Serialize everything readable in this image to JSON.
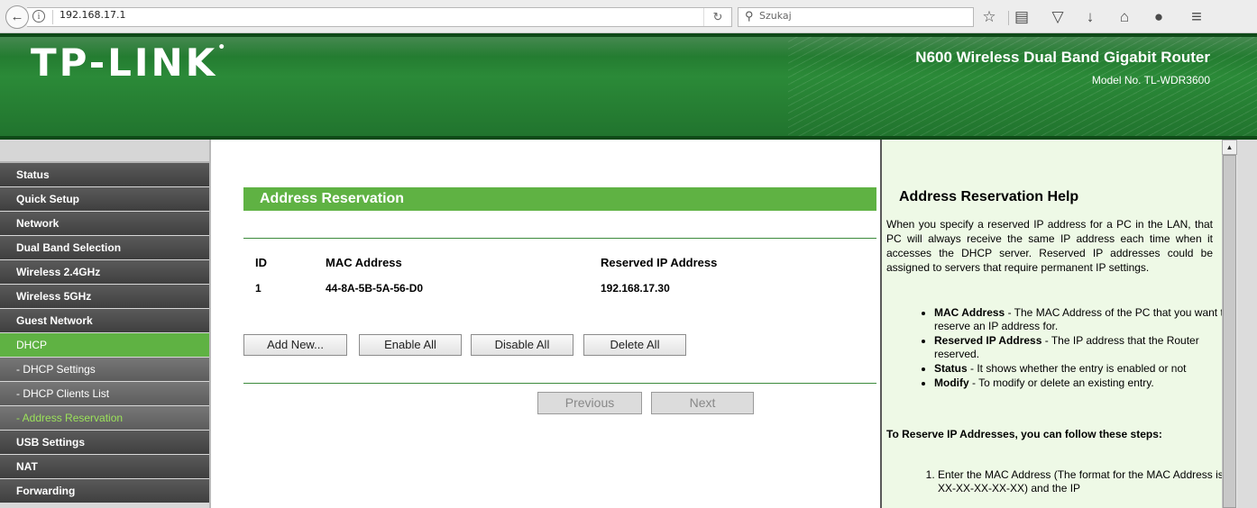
{
  "browser": {
    "back_icon": "back-arrow-icon",
    "info_icon": "info-icon",
    "url": "192.168.17.1",
    "reload_icon": "reload-icon",
    "search_placeholder": "Szukaj",
    "toolbar_icons": [
      "star-icon",
      "reading-list-icon",
      "pocket-icon",
      "download-icon",
      "home-icon",
      "chat-icon",
      "menu-icon"
    ]
  },
  "banner": {
    "logo": "TP-LINK",
    "product": "N600 Wireless Dual Band Gigabit Router",
    "model": "Model No. TL-WDR3600"
  },
  "menu": {
    "items": [
      {
        "label": "Status"
      },
      {
        "label": "Quick Setup"
      },
      {
        "label": "Network"
      },
      {
        "label": "Dual Band Selection"
      },
      {
        "label": "Wireless 2.4GHz"
      },
      {
        "label": "Wireless 5GHz"
      },
      {
        "label": "Guest Network"
      },
      {
        "label": "DHCP"
      },
      {
        "label": "- DHCP Settings"
      },
      {
        "label": "- DHCP Clients List"
      },
      {
        "label": "- Address Reservation"
      },
      {
        "label": "USB Settings"
      },
      {
        "label": "NAT"
      },
      {
        "label": "Forwarding"
      }
    ]
  },
  "main": {
    "title": "Address Reservation",
    "columns": [
      "ID",
      "MAC Address",
      "Reserved IP Address"
    ],
    "rows": [
      {
        "id": "1",
        "mac": "44-8A-5B-5A-56-D0",
        "ip": "192.168.17.30"
      }
    ],
    "buttons": {
      "add": "Add New...",
      "enable": "Enable All",
      "disable": "Disable All",
      "delete": "Delete All",
      "previous": "Previous",
      "next": "Next"
    }
  },
  "help": {
    "title": "Address Reservation Help",
    "intro": "When you specify a reserved IP address for a PC in the LAN, that PC will always receive the same IP address each time when it accesses the DHCP server. Reserved IP addresses could be assigned to servers that require permanent IP settings.",
    "items": [
      {
        "term": "MAC Address",
        "desc": " - The MAC Address of the PC that you want to reserve an IP address for."
      },
      {
        "term": "Reserved IP Address",
        "desc": " - The IP address that the Router reserved."
      },
      {
        "term": "Status",
        "desc": " - It shows whether the entry is enabled or not"
      },
      {
        "term": "Modify",
        "desc": " - To modify or delete an existing entry."
      }
    ],
    "steps_title": "To Reserve IP Addresses, you can follow these steps:",
    "step1": "Enter the MAC Address (The format for the MAC Address is XX-XX-XX-XX-XX-XX) and the IP"
  },
  "colors": {
    "accent": "#5fb243",
    "banner": "#2b8a38",
    "help_bg": "#eef9e6",
    "menu_dark": "#4a4a4a",
    "active_sub": "#9be25a"
  }
}
